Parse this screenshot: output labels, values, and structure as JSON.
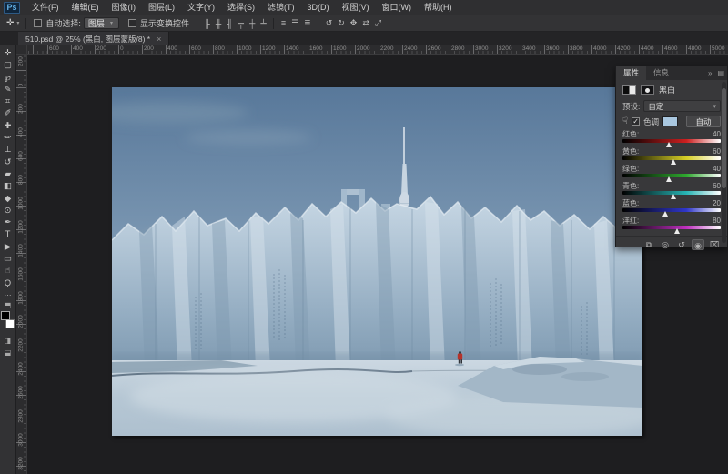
{
  "window": {
    "logo": "Ps"
  },
  "menu_bar": {
    "items": [
      "文件(F)",
      "编辑(E)",
      "图像(I)",
      "图层(L)",
      "文字(Y)",
      "选择(S)",
      "滤镜(T)",
      "3D(D)",
      "视图(V)",
      "窗口(W)",
      "帮助(H)"
    ]
  },
  "options_bar": {
    "tool_icon_glyph": "✛",
    "auto_select_label": "自动选择:",
    "auto_select_value": "图层",
    "show_transform_label": "显示变换控件",
    "align_icons": [
      {
        "name": "align-left-edges-icon",
        "glyph": "╟"
      },
      {
        "name": "align-horizontal-centers-icon",
        "glyph": "╫"
      },
      {
        "name": "align-right-edges-icon",
        "glyph": "╢"
      },
      {
        "name": "align-top-edges-icon",
        "glyph": "╤"
      },
      {
        "name": "align-vertical-centers-icon",
        "glyph": "╪"
      },
      {
        "name": "align-bottom-edges-icon",
        "glyph": "╧"
      }
    ],
    "distribute_icons": [
      {
        "name": "distribute-top-icon",
        "glyph": "≡"
      },
      {
        "name": "distribute-center-icon",
        "glyph": "☰"
      },
      {
        "name": "distribute-bottom-icon",
        "glyph": "≣"
      }
    ],
    "threed_icons": [
      {
        "name": "3d-rotate-icon",
        "glyph": "↺"
      },
      {
        "name": "3d-roll-icon",
        "glyph": "↻"
      },
      {
        "name": "3d-drag-icon",
        "glyph": "✥"
      },
      {
        "name": "3d-slide-icon",
        "glyph": "⇄"
      },
      {
        "name": "3d-scale-icon",
        "glyph": "⤢"
      }
    ]
  },
  "document_tab": {
    "title": "510.psd @ 25% (黑白, 图层蒙版/8) *",
    "close_glyph": "×"
  },
  "toolbar": {
    "tools": [
      {
        "name": "move-tool",
        "glyph": "✛"
      },
      {
        "name": "marquee-tool",
        "glyph": "▢"
      },
      {
        "name": "lasso-tool",
        "glyph": "℘"
      },
      {
        "name": "quick-selection-tool",
        "glyph": "✎"
      },
      {
        "name": "crop-tool",
        "glyph": "⌗"
      },
      {
        "name": "eyedropper-tool",
        "glyph": "✐"
      },
      {
        "name": "healing-brush-tool",
        "glyph": "✚"
      },
      {
        "name": "brush-tool",
        "glyph": "✏"
      },
      {
        "name": "clone-stamp-tool",
        "glyph": "⊥"
      },
      {
        "name": "history-brush-tool",
        "glyph": "↺"
      },
      {
        "name": "eraser-tool",
        "glyph": "▰"
      },
      {
        "name": "gradient-tool",
        "glyph": "◧"
      },
      {
        "name": "blur-tool",
        "glyph": "◆"
      },
      {
        "name": "dodge-tool",
        "glyph": "⊙"
      },
      {
        "name": "pen-tool",
        "glyph": "✒"
      },
      {
        "name": "type-tool",
        "glyph": "T"
      },
      {
        "name": "path-selection-tool",
        "glyph": "▶"
      },
      {
        "name": "shape-tool",
        "glyph": "▭"
      },
      {
        "name": "hand-tool",
        "glyph": "☝"
      },
      {
        "name": "zoom-tool",
        "glyph": "Ϙ"
      }
    ],
    "edit_toolbar_glyph": "⋯",
    "swap_colors_glyph": "⬒",
    "quick_mask_glyph": "◨",
    "screen_mode_glyph": "⬓",
    "foreground_color": "#000000",
    "background_color": "#ffffff"
  },
  "rulers": {
    "top_labels": [
      "600",
      "400",
      "200",
      "0",
      "200",
      "400",
      "600",
      "800",
      "1000",
      "1200",
      "1400",
      "1600",
      "1800",
      "2000",
      "2200",
      "2400",
      "2600",
      "2800",
      "3000",
      "3200",
      "3400",
      "3600",
      "3800",
      "4000",
      "4200",
      "4400",
      "4600",
      "4800",
      "5000"
    ],
    "left_labels": [
      "200",
      "0",
      "200",
      "400",
      "600",
      "800",
      "1000",
      "1200",
      "1400",
      "1600",
      "1800",
      "2000",
      "2200",
      "2400",
      "2600",
      "2800",
      "3000",
      "3200"
    ]
  },
  "properties_panel": {
    "tabs": [
      {
        "label": "属性",
        "active": true
      },
      {
        "label": "信息",
        "active": false
      }
    ],
    "collapse_glyph": "»",
    "menu_glyph": "▤",
    "adjustment_name": "黑白",
    "preset_label": "预设:",
    "preset_value": "自定",
    "preset_caret_glyph": "▾",
    "tat_icon_glyph": "☟",
    "tint_checked_glyph": "✓",
    "tint_label": "色调",
    "tint_color": "#a9c7e0",
    "auto_button_label": "自动",
    "slider_range": {
      "min": -200,
      "max": 300
    },
    "sliders": [
      {
        "label": "红色:",
        "value": 40,
        "color": "#cc1f1f"
      },
      {
        "label": "黄色:",
        "value": 60,
        "color": "#d6cf26"
      },
      {
        "label": "绿色:",
        "value": 40,
        "color": "#2ea82e"
      },
      {
        "label": "青色:",
        "value": 60,
        "color": "#27b3b3"
      },
      {
        "label": "蓝色:",
        "value": 20,
        "color": "#2f36c9"
      },
      {
        "label": "洋红:",
        "value": 80,
        "color": "#bf2fbf"
      }
    ],
    "footer_icons": [
      {
        "name": "clip-to-layer-icon",
        "glyph": "⧉",
        "pressed": false
      },
      {
        "name": "view-previous-state-icon",
        "glyph": "◎",
        "pressed": false
      },
      {
        "name": "reset-adjustment-icon",
        "glyph": "↺",
        "pressed": false
      },
      {
        "name": "visibility-eye-icon",
        "glyph": "◉",
        "pressed": true
      },
      {
        "name": "delete-adjustment-icon",
        "glyph": "⌧",
        "pressed": false
      }
    ]
  },
  "canvas_image": {
    "description": "Frozen city: towering ice wall with skyscrapers and TV tower encased in ice, tiny red-jacketed figure on snow plain under blue sky",
    "sky_top_color": "#58789a",
    "sky_horizon_color": "#c9d5de",
    "ice_light_color": "#c7d7e4",
    "ice_shadow_color": "#7e99b0",
    "snow_color": "#b6c7d4",
    "figure_color": "#b5322a"
  }
}
